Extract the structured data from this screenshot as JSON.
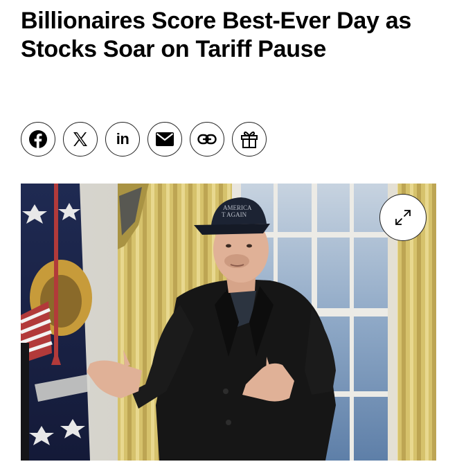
{
  "article": {
    "headline": "Billionaires Score Best-Ever Day as Stocks Soar on Tariff Pause"
  },
  "share": {
    "buttons": [
      {
        "name": "facebook",
        "icon": "facebook-icon"
      },
      {
        "name": "x",
        "icon": "x-icon"
      },
      {
        "name": "linkedin",
        "icon": "linkedin-icon",
        "label": "in"
      },
      {
        "name": "email",
        "icon": "envelope-icon"
      },
      {
        "name": "copy-link",
        "icon": "link-icon"
      },
      {
        "name": "gift",
        "icon": "gift-icon"
      }
    ]
  },
  "photo": {
    "cap_text_line1": "AMERICA",
    "cap_text_line2": "T AGAIN",
    "expand_icon": "expand-arrows-icon"
  },
  "colors": {
    "text": "#000000",
    "background": "#ffffff",
    "curtain": "#d8c36a",
    "window": "#9fb5cf",
    "coat": "#161616"
  }
}
